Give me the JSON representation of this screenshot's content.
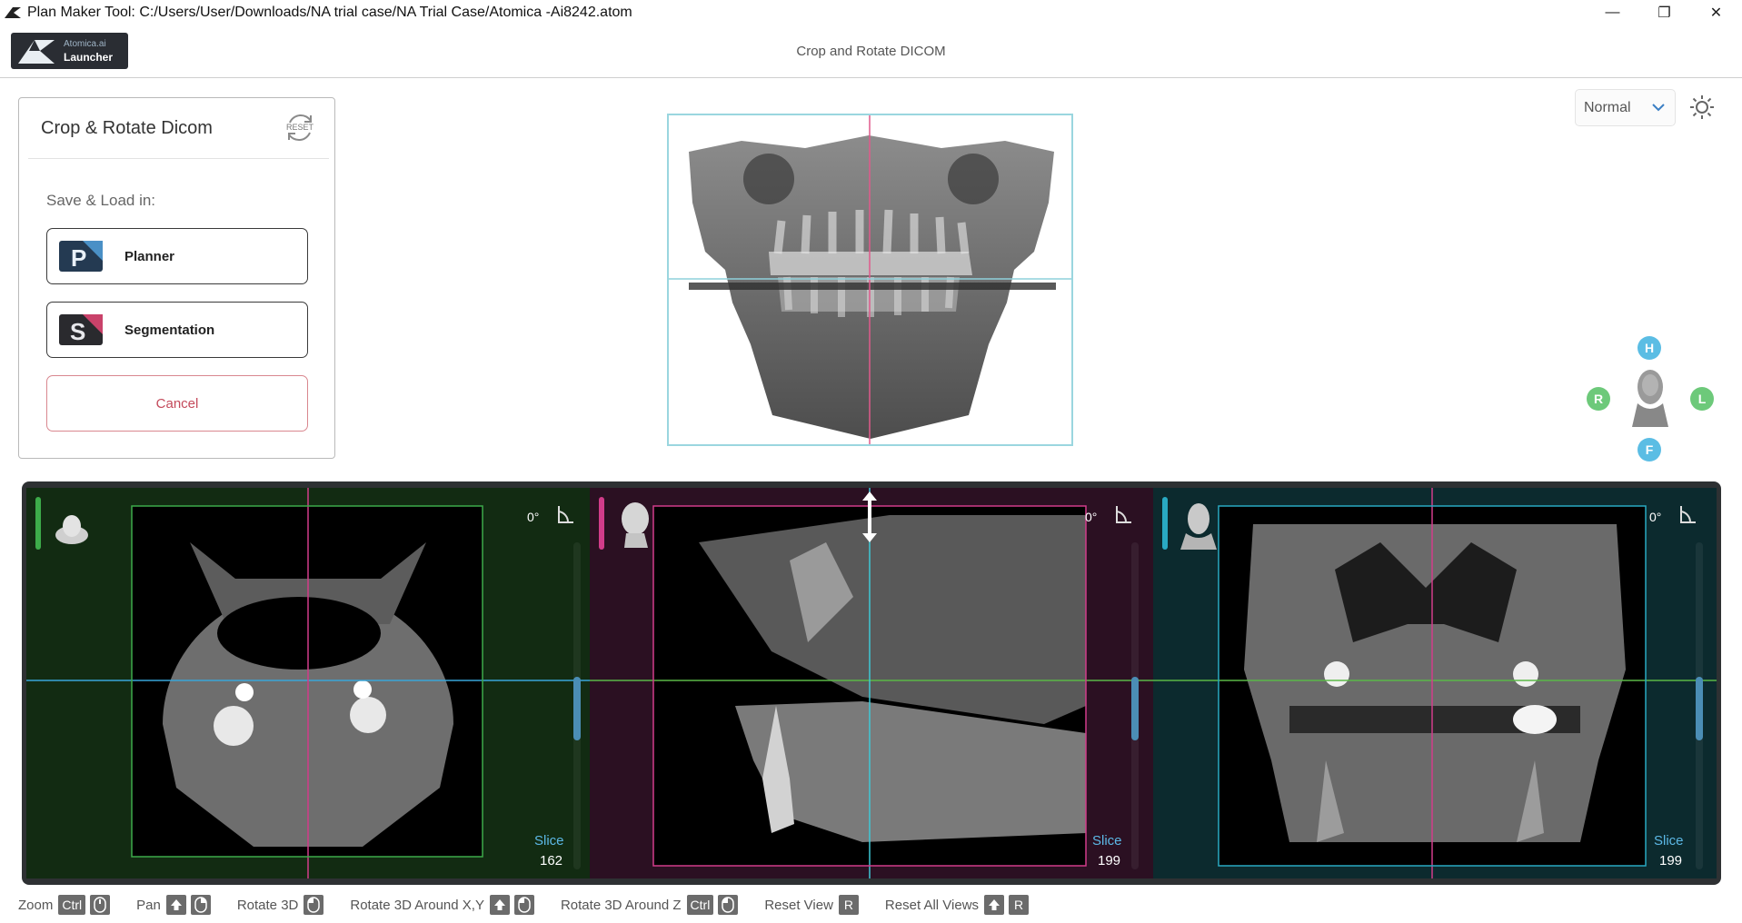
{
  "window": {
    "title": "Plan Maker Tool: C:/Users/User/Downloads/NA trial case/NA Trial Case/Atomica -Ai8242.atom",
    "minimize": "—",
    "restore": "❐",
    "close": "✕"
  },
  "header": {
    "logo_brand": "Atomica.ai",
    "logo_product": "Launcher",
    "title": "Crop and Rotate DICOM"
  },
  "panel": {
    "title": "Crop & Rotate Dicom",
    "reset_label": "RESET",
    "save_label": "Save & Load in:",
    "planner": "Planner",
    "planner_icon_letter": "P",
    "segmentation": "Segmentation",
    "segmentation_icon_letter": "S",
    "cancel": "Cancel"
  },
  "toolbar": {
    "mode": "Normal"
  },
  "orientation": {
    "head": "H",
    "right": "R",
    "left": "L",
    "front": "F"
  },
  "viewports": [
    {
      "name": "axial",
      "angle": "0°",
      "slice_label": "Slice",
      "slice": "162",
      "accent": "#3dab4a",
      "bg": "#122b12"
    },
    {
      "name": "sagittal",
      "angle": "0°",
      "slice_label": "Slice",
      "slice": "199",
      "accent": "#d13c8a",
      "bg": "#2b1022"
    },
    {
      "name": "coronal",
      "angle": "0°",
      "slice_label": "Slice",
      "slice": "199",
      "accent": "#29a9c2",
      "bg": "#0c2a2e"
    }
  ],
  "shortcuts": [
    {
      "label": "Zoom",
      "keys": [
        "Ctrl",
        "mouse-scroll"
      ]
    },
    {
      "label": "Pan",
      "keys": [
        "shift-up",
        "mouse-right"
      ]
    },
    {
      "label": "Rotate 3D",
      "keys": [
        "mouse-left"
      ]
    },
    {
      "label": "Rotate 3D Around X,Y",
      "keys": [
        "shift-up",
        "mouse-left"
      ]
    },
    {
      "label": "Rotate 3D Around Z",
      "keys": [
        "Ctrl",
        "mouse-left"
      ]
    },
    {
      "label": "Reset View",
      "keys": [
        "R"
      ]
    },
    {
      "label": "Reset All Views",
      "keys": [
        "shift-up",
        "R"
      ]
    }
  ]
}
